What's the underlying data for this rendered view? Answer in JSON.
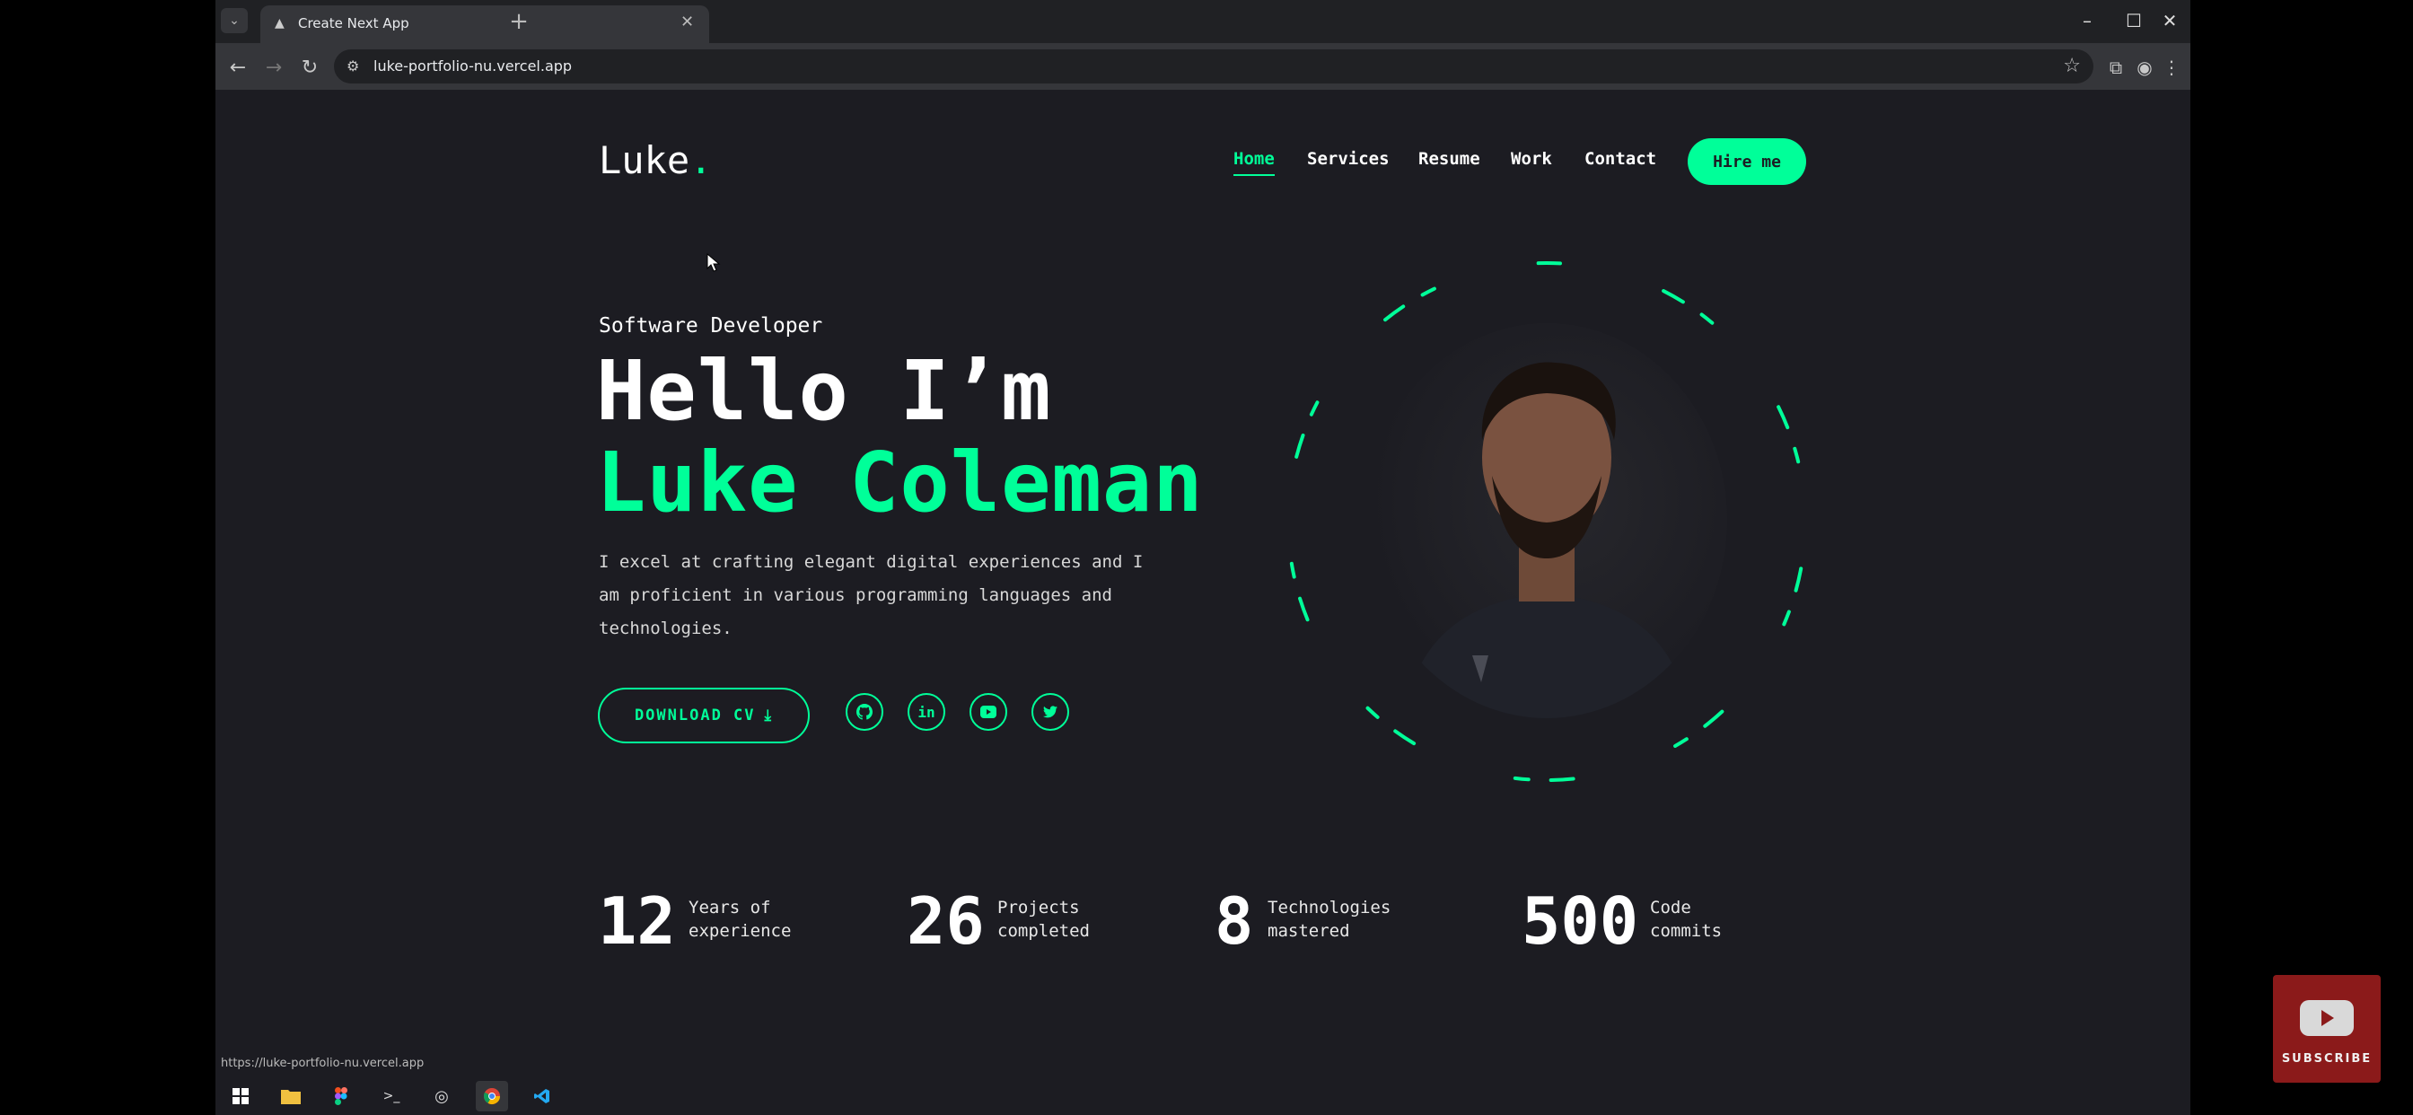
{
  "browser": {
    "tab_title": "Create Next App",
    "url": "luke-portfolio-nu.vercel.app",
    "status_url": "https://luke-portfolio-nu.vercel.app"
  },
  "site": {
    "logo": "Luke",
    "logo_dot": ".",
    "nav": [
      "Home",
      "Services",
      "Resume",
      "Work",
      "Contact"
    ],
    "active_nav": "Home",
    "hire_label": "Hire me",
    "role": "Software Developer",
    "hello": "Hello I’m",
    "name": "Luke Coleman",
    "description": "I excel at crafting elegant digital experiences and I am proficient in various programming languages and technologies.",
    "download_label": "DOWNLOAD CV",
    "socials": [
      "github-icon",
      "linkedin-icon",
      "youtube-icon",
      "twitter-icon"
    ],
    "stats": [
      {
        "num": "12",
        "label1": "Years of",
        "label2": "experience"
      },
      {
        "num": "26",
        "label1": "Projects",
        "label2": "completed"
      },
      {
        "num": "8",
        "label1": "Technologies",
        "label2": "mastered"
      },
      {
        "num": "500",
        "label1": "Code",
        "label2": "commits"
      }
    ],
    "accent": "#00ff99",
    "background": "#1c1c22"
  },
  "overlay": {
    "subscribe_label": "SUBSCRIBE"
  }
}
